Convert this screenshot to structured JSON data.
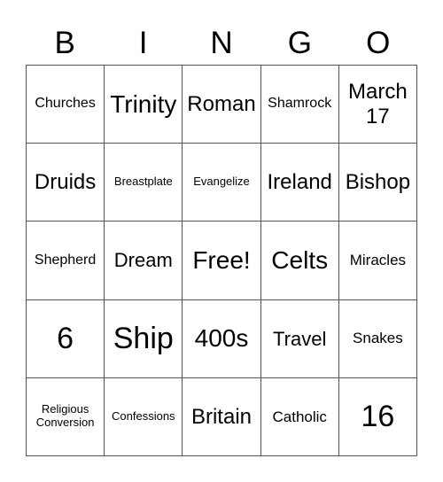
{
  "header": [
    "B",
    "I",
    "N",
    "G",
    "O"
  ],
  "rows": [
    [
      "Churches",
      "Trinity",
      "Roman",
      "Shamrock",
      "March 17"
    ],
    [
      "Druids",
      "Breastplate",
      "Evangelize",
      "Ireland",
      "Bishop"
    ],
    [
      "Shepherd",
      "Dream",
      "Free!",
      "Celts",
      "Miracles"
    ],
    [
      "6",
      "Ship",
      "400s",
      "Travel",
      "Snakes"
    ],
    [
      "Religious Conversion",
      "Confessions",
      "Britain",
      "Catholic",
      "16"
    ]
  ]
}
